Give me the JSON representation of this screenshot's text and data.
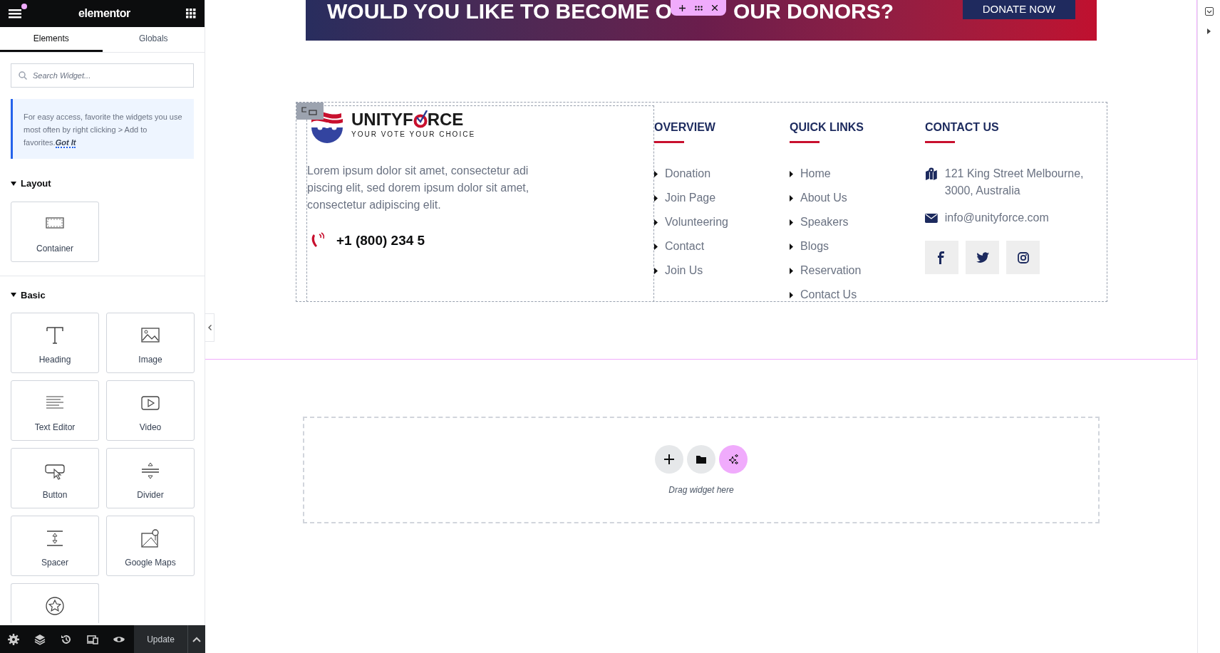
{
  "editor_header": {
    "logo": "elementor"
  },
  "panel_tabs": [
    {
      "label": "Elements",
      "selected": true
    },
    {
      "label": "Globals",
      "selected": false
    }
  ],
  "search": {
    "placeholder": "Search Widget..."
  },
  "tip": {
    "text": "For easy access, favorite the widgets you use most often by right clicking > Add to favorites.",
    "action": "Got It"
  },
  "categories": [
    {
      "title": "Layout",
      "expanded": true,
      "widgets": [
        {
          "kind": "container",
          "label": "Container"
        }
      ]
    },
    {
      "title": "Basic",
      "expanded": true,
      "widgets": [
        {
          "kind": "heading",
          "label": "Heading"
        },
        {
          "kind": "image",
          "label": "Image"
        },
        {
          "kind": "text",
          "label": "Text Editor"
        },
        {
          "kind": "video",
          "label": "Video"
        },
        {
          "kind": "button",
          "label": "Button"
        },
        {
          "kind": "divider",
          "label": "Divider"
        },
        {
          "kind": "spacer",
          "label": "Spacer"
        },
        {
          "kind": "map",
          "label": "Google Maps"
        },
        {
          "kind": "star"
        }
      ]
    }
  ],
  "bottom_bar": {
    "update_button": "Update"
  },
  "banner": {
    "heading_start": "WOULD YOU LIKE TO BECOME O",
    "heading_end": "OUR DONORS?",
    "button": "DONATE NOW"
  },
  "footer": {
    "brand": {
      "name_start": "UNITYF",
      "name_end": "RCE",
      "tagline": "YOUR VOTE YOUR CHOICE"
    },
    "about": "Lorem ipsum dolor sit amet, consectetur adi piscing elit, sed dorem ipsum dolor sit amet, consectetur adipiscing elit.",
    "phone": "+1 (800) 234 5",
    "link_columns": [
      {
        "title": "OVERVIEW",
        "links": [
          "Donation",
          "Join Page",
          "Volunteering",
          "Contact",
          "Join Us"
        ]
      },
      {
        "title": "QUICK LINKS",
        "links": [
          "Home",
          "About Us",
          "Speakers",
          "Blogs",
          "Reservation",
          "Contact Us"
        ]
      }
    ],
    "contact": {
      "title": "CONTACT US",
      "items": [
        {
          "kind": "address",
          "text": "121 King Street Melbourne, 3000, Australia"
        },
        {
          "kind": "email",
          "text": "info@unityforce.com"
        }
      ],
      "social": [
        {
          "kind": "facebook"
        },
        {
          "kind": "twitter"
        },
        {
          "kind": "instagram"
        }
      ]
    }
  },
  "dropzone": {
    "hint": "Drag widget here"
  }
}
